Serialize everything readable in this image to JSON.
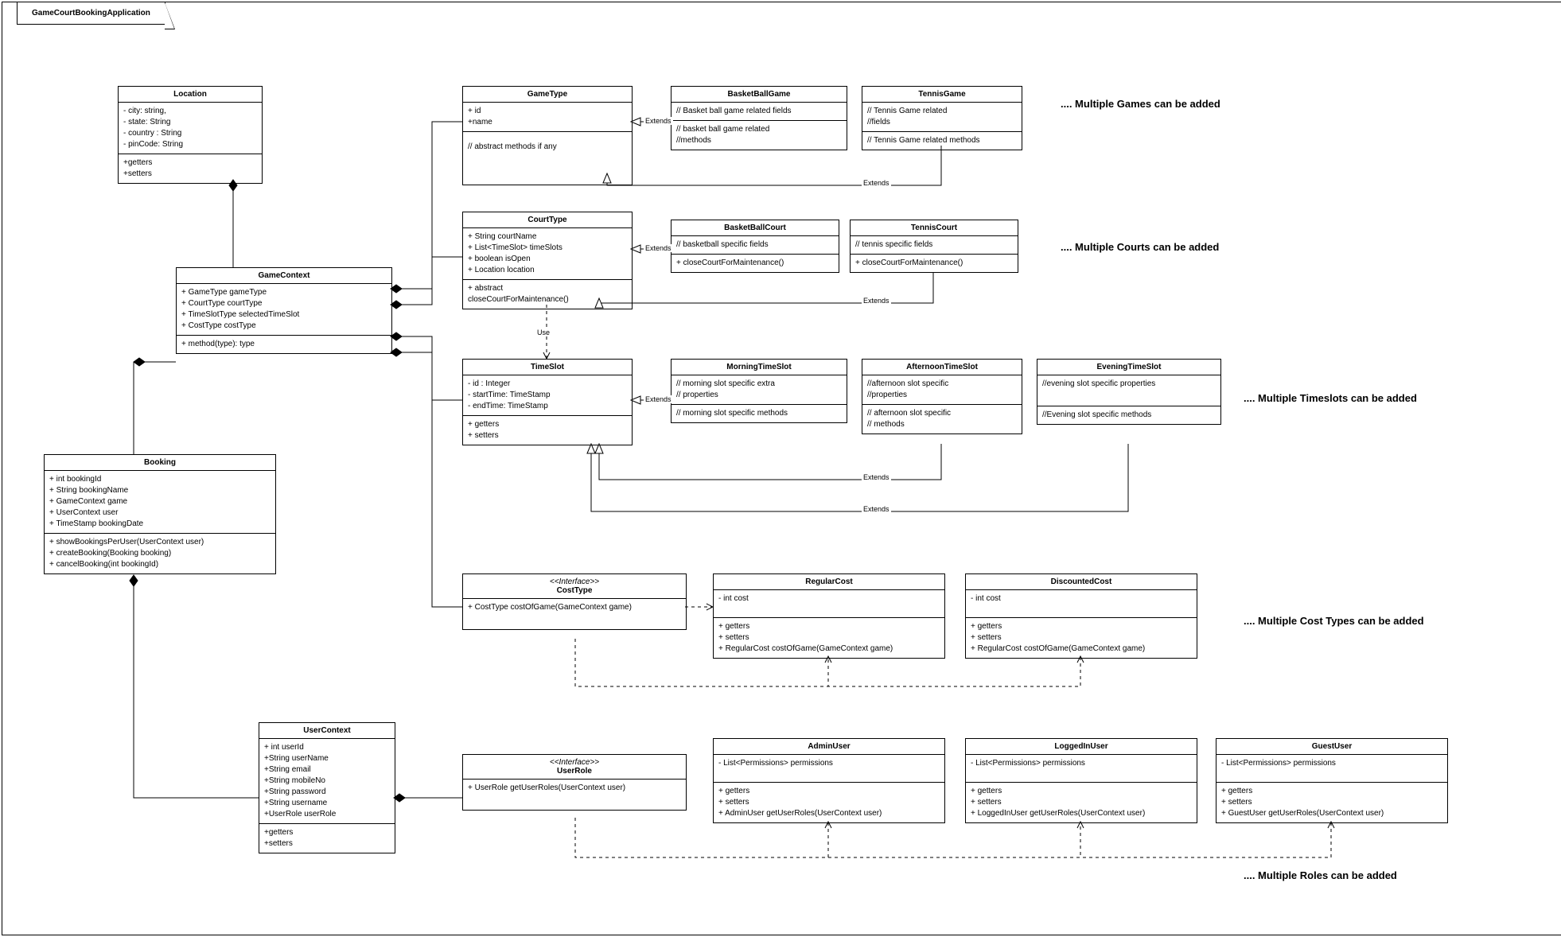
{
  "title": "GameCourtBookingApplication",
  "classes": {
    "location": {
      "name": "Location",
      "attrs": [
        "- city: string,",
        "- state: String",
        "- country : String",
        "- pinCode: String"
      ],
      "ops": [
        "+getters",
        "+setters"
      ]
    },
    "gamecontext": {
      "name": "GameContext",
      "attrs": [
        "+ GameType gameType",
        "+ CourtType courtType",
        "+ TimeSlotType selectedTimeSlot",
        "+ CostType costType"
      ],
      "ops": [
        "+ method(type): type"
      ]
    },
    "booking": {
      "name": "Booking",
      "attrs": [
        "+ int bookingId",
        "+ String bookingName",
        "+ GameContext game",
        "+ UserContext user",
        "+ TimeStamp bookingDate"
      ],
      "ops": [
        "+ showBookingsPerUser(UserContext user)",
        "+ createBooking(Booking booking)",
        "+ cancelBooking(int bookingId)"
      ]
    },
    "gametype": {
      "name": "GameType",
      "attrs": [
        "+ id",
        "+name"
      ],
      "ops": [
        "// abstract methods if any"
      ]
    },
    "basketballgame": {
      "name": "BasketBallGame",
      "attrs": [
        "// Basket ball game related fields"
      ],
      "ops": [
        "// basket ball game related",
        "//methods"
      ]
    },
    "tennisgame": {
      "name": "TennisGame",
      "attrs": [
        "// Tennis Game related",
        "//fields"
      ],
      "ops": [
        "// Tennis Game related methods"
      ]
    },
    "courttype": {
      "name": "CourtType",
      "attrs": [
        "+ String courtName",
        "+ List<TimeSlot> timeSlots",
        "+ boolean isOpen",
        "+ Location location"
      ],
      "ops": [
        "+ abstract",
        "closeCourtForMaintenance()"
      ]
    },
    "basketballcourt": {
      "name": "BasketBallCourt",
      "attrs": [
        "// basketball specific fields"
      ],
      "ops": [
        "+ closeCourtForMaintenance()"
      ]
    },
    "tenniscourt": {
      "name": "TennisCourt",
      "attrs": [
        "// tennis specific fields"
      ],
      "ops": [
        "+ closeCourtForMaintenance()"
      ]
    },
    "timeslot": {
      "name": "TimeSlot",
      "attrs": [
        "- id : Integer",
        "- startTime: TimeStamp",
        "- endTime: TimeStamp"
      ],
      "ops": [
        "+ getters",
        "+ setters"
      ]
    },
    "morningslot": {
      "name": "MorningTimeSlot",
      "attrs": [
        "// morning slot specific extra",
        "// properties"
      ],
      "ops": [
        "// morning slot specific methods"
      ]
    },
    "afternoonslot": {
      "name": "AfternoonTimeSlot",
      "attrs": [
        "//afternoon slot specific",
        "//properties"
      ],
      "ops": [
        "// afternoon slot specific",
        "// methods"
      ]
    },
    "eveningslot": {
      "name": "EveningTimeSlot",
      "attrs": [
        "//evening slot specific properties"
      ],
      "ops": [
        "//Evening slot specific methods"
      ]
    },
    "costtype": {
      "stereo": "<<Interface>>",
      "name": "CostType",
      "ops": [
        "+ CostType costOfGame(GameContext game)"
      ]
    },
    "regularcost": {
      "name": "RegularCost",
      "attrs": [
        "- int cost"
      ],
      "ops": [
        "+ getters",
        "+ setters",
        "+ RegularCost costOfGame(GameContext game)"
      ]
    },
    "discountedcost": {
      "name": "DiscountedCost",
      "attrs": [
        "- int cost"
      ],
      "ops": [
        "+ getters",
        "+ setters",
        "+ RegularCost costOfGame(GameContext game)"
      ]
    },
    "usercontext": {
      "name": "UserContext",
      "attrs": [
        "+ int  userId",
        "+String userName",
        "+String email",
        "+String mobileNo",
        "+String password",
        "+String username",
        "+UserRole userRole"
      ],
      "ops": [
        "+getters",
        "+setters"
      ]
    },
    "userrole": {
      "stereo": "<<Interface>>",
      "name": "UserRole",
      "ops": [
        "+ UserRole getUserRoles(UserContext user)"
      ]
    },
    "adminuser": {
      "name": "AdminUser",
      "attrs": [
        "- List<Permissions> permissions"
      ],
      "ops": [
        "+ getters",
        "+ setters",
        "+ AdminUser getUserRoles(UserContext user)"
      ]
    },
    "loggedinuser": {
      "name": "LoggedInUser",
      "attrs": [
        "- List<Permissions> permissions"
      ],
      "ops": [
        "+ getters",
        "+ setters",
        "+ LoggedInUser getUserRoles(UserContext user)"
      ]
    },
    "guestuser": {
      "name": "GuestUser",
      "attrs": [
        "- List<Permissions> permissions"
      ],
      "ops": [
        "+ getters",
        "+ setters",
        "+ GuestUser getUserRoles(UserContext user)"
      ]
    }
  },
  "notes": {
    "games": ".... Multiple Games can be added",
    "courts": ".... Multiple Courts can be added",
    "timeslots": ".... Multiple Timeslots  can be added",
    "costs": ".... Multiple Cost Types can be added",
    "roles": ".... Multiple Roles can be added"
  },
  "labels": {
    "extends": "Extends",
    "use": "Use"
  }
}
